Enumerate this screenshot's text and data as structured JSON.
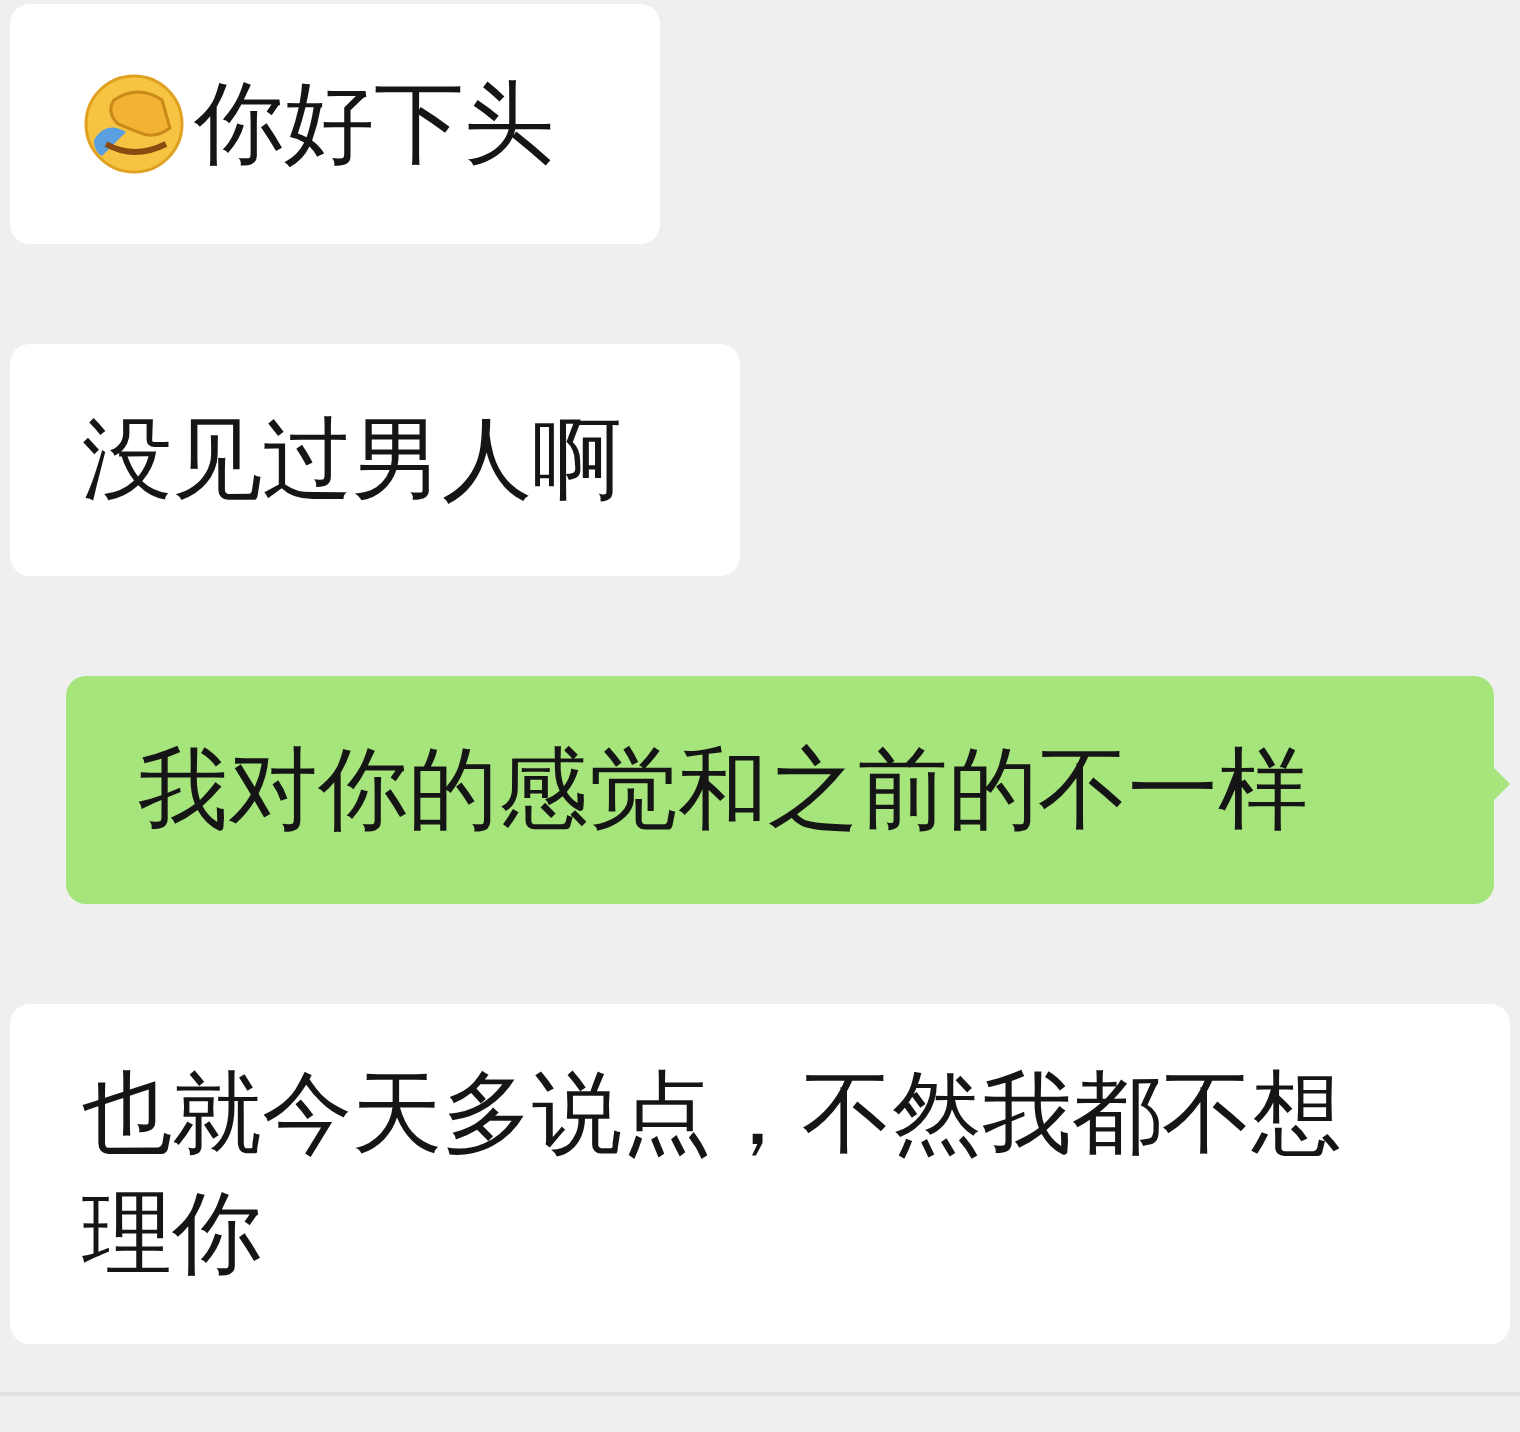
{
  "messages": [
    {
      "kind": "received",
      "emoji": true,
      "text": "你好下头"
    },
    {
      "kind": "received",
      "text": "没见过男人啊"
    },
    {
      "kind": "sent",
      "text": "我对你的感觉和之前的不一样"
    },
    {
      "kind": "received",
      "text": "也就今天多说点，不然我都不想理你"
    }
  ]
}
